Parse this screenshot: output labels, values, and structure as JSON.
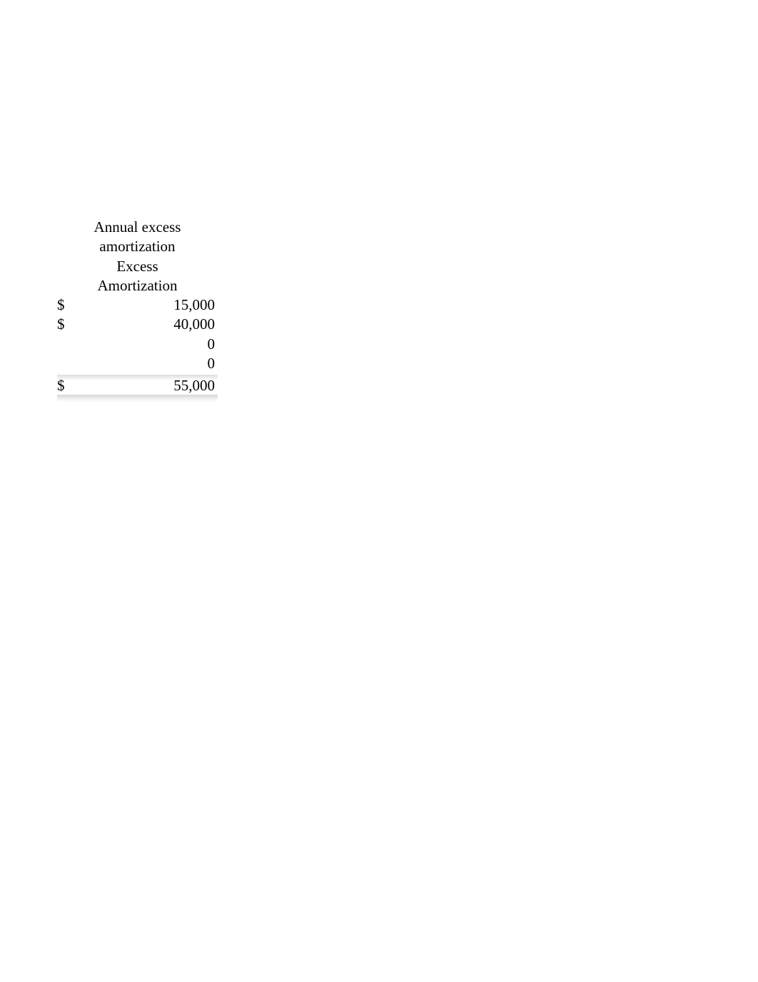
{
  "table": {
    "title": "Annual excess amortization",
    "header_line1": "Excess",
    "header_line2": "Amortization",
    "rows": [
      {
        "currency": "$",
        "amount": "15,000"
      },
      {
        "currency": "$",
        "amount": "40,000"
      },
      {
        "currency": "",
        "amount": "0"
      },
      {
        "currency": "",
        "amount": "0"
      }
    ],
    "total": {
      "currency": "$",
      "amount": "55,000"
    }
  }
}
